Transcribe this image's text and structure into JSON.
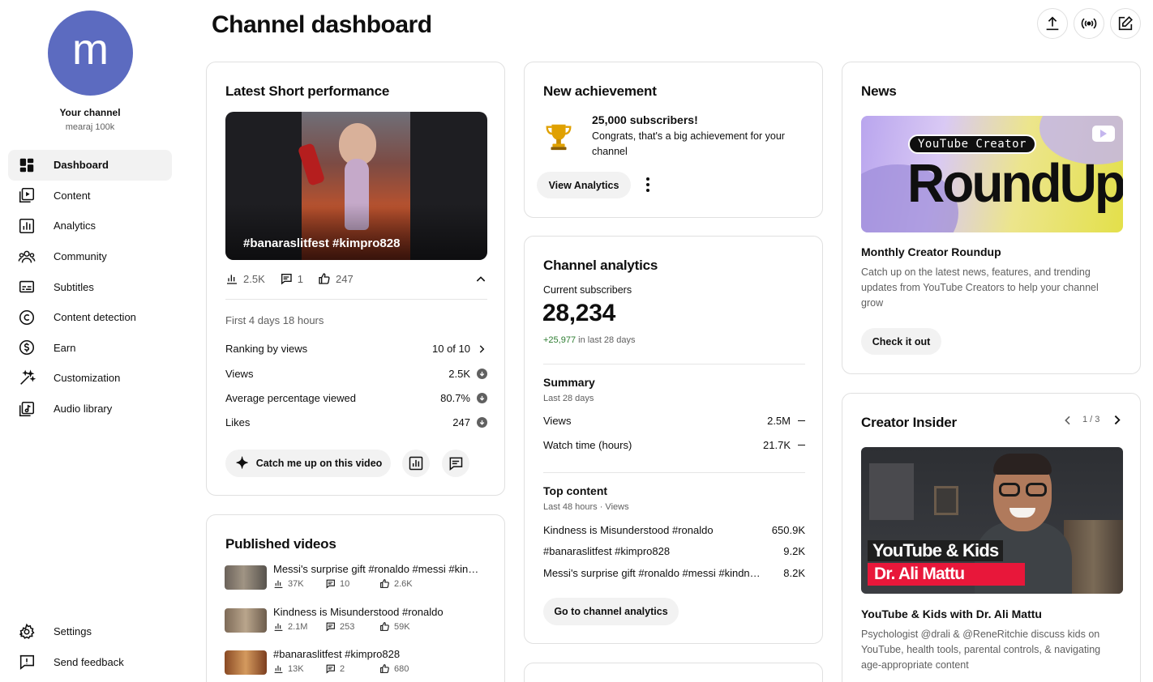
{
  "sidebar": {
    "avatar_letter": "m",
    "your_channel_label": "Your channel",
    "channel_name": "mearaj 100k",
    "items": [
      {
        "label": "Dashboard",
        "icon": "dashboard-icon"
      },
      {
        "label": "Content",
        "icon": "content-icon"
      },
      {
        "label": "Analytics",
        "icon": "analytics-icon"
      },
      {
        "label": "Community",
        "icon": "community-icon"
      },
      {
        "label": "Subtitles",
        "icon": "subtitles-icon"
      },
      {
        "label": "Content detection",
        "icon": "copyright-icon"
      },
      {
        "label": "Earn",
        "icon": "earn-icon"
      },
      {
        "label": "Customization",
        "icon": "magic-wand-icon"
      },
      {
        "label": "Audio library",
        "icon": "audio-library-icon"
      }
    ],
    "bottom_items": [
      {
        "label": "Settings",
        "icon": "gear-icon"
      },
      {
        "label": "Send feedback",
        "icon": "feedback-icon"
      }
    ]
  },
  "header": {
    "title": "Channel dashboard"
  },
  "latest_short": {
    "title": "Latest Short performance",
    "thumb_caption": "#banaraslitfest #kimpro828",
    "views": "2.5K",
    "comments": "1",
    "likes": "247",
    "period": "First 4 days 18 hours",
    "rows": [
      {
        "label": "Ranking by views",
        "value": "10 of 10"
      },
      {
        "label": "Views",
        "value": "2.5K"
      },
      {
        "label": "Average percentage viewed",
        "value": "80.7%"
      },
      {
        "label": "Likes",
        "value": "247"
      }
    ],
    "catch_up_label": "Catch me up on this video"
  },
  "published": {
    "title": "Published videos",
    "items": [
      {
        "title": "Messi's surprise gift #ronaldo #messi #kindness",
        "views": "37K",
        "comments": "10",
        "likes": "2.6K"
      },
      {
        "title": "Kindness is Misunderstood #ronaldo",
        "views": "2.1M",
        "comments": "253",
        "likes": "59K"
      },
      {
        "title": "#banaraslitfest #kimpro828",
        "views": "13K",
        "comments": "2",
        "likes": "680"
      }
    ]
  },
  "achievement": {
    "title": "New achievement",
    "headline": "25,000 subscribers!",
    "body": "Congrats, that's a big achievement for your channel",
    "button": "View Analytics"
  },
  "analytics": {
    "title": "Channel analytics",
    "subs_label": "Current subscribers",
    "subs_value": "28,234",
    "subs_delta": "+25,977",
    "subs_delta_suffix": "in last 28 days",
    "summary_title": "Summary",
    "summary_period": "Last 28 days",
    "summary_rows": [
      {
        "label": "Views",
        "value": "2.5M"
      },
      {
        "label": "Watch time (hours)",
        "value": "21.7K"
      }
    ],
    "top_title": "Top content",
    "top_period": "Last 48 hours · Views",
    "top_rows": [
      {
        "label": "Kindness is Misunderstood #ronaldo",
        "value": "650.9K"
      },
      {
        "label": "#banaraslitfest #kimpro828",
        "value": "9.2K"
      },
      {
        "label": "Messi's surprise gift #ronaldo #messi #kindness",
        "value": "8.2K"
      }
    ],
    "button": "Go to channel analytics"
  },
  "news": {
    "title": "News",
    "banner_tag": "YouTube Creator",
    "banner_big": "RoundUp",
    "headline": "Monthly Creator Roundup",
    "body": "Catch up on the latest news, features, and trending updates from YouTube Creators to help your channel grow",
    "button": "Check it out"
  },
  "insider": {
    "title": "Creator Insider",
    "pager": "1 / 3",
    "thumb_line1": "YouTube & Kids",
    "thumb_line2": "Dr. Ali Mattu",
    "headline": "YouTube & Kids with Dr. Ali Mattu",
    "body": "Psychologist @drali & @ReneRitchie discuss kids on YouTube, health tools, parental controls, & navigating age-appropriate content"
  },
  "colors": {
    "avatar": "#5c6bc0",
    "positive": "#2e7d32",
    "pill_bg": "#f2f2f2",
    "red_banner": "#e8173a"
  }
}
